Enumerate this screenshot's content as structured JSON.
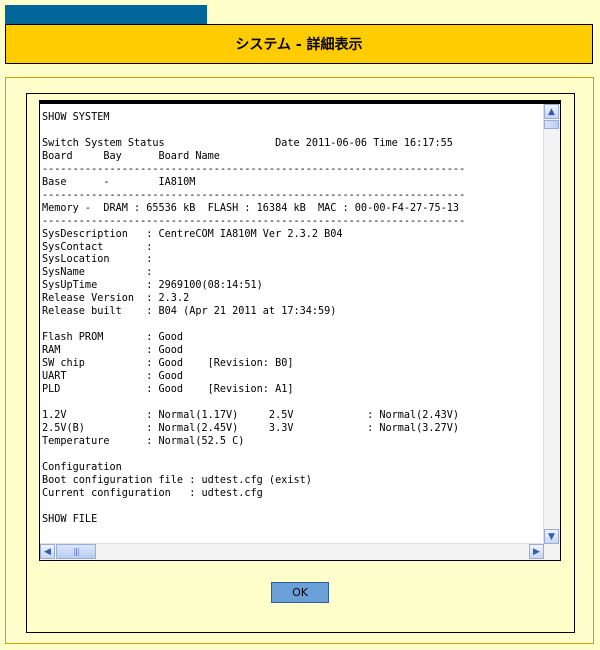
{
  "header": {
    "title": "システム - 詳細表示"
  },
  "output": {
    "text": "SHOW SYSTEM\n\nSwitch System Status                  Date 2011-06-06 Time 16:17:55\nBoard     Bay      Board Name\n---------------------------------------------------------------------\nBase      -        IA810M\n---------------------------------------------------------------------\nMemory -  DRAM : 65536 kB  FLASH : 16384 kB  MAC : 00-00-F4-27-75-13\n---------------------------------------------------------------------\nSysDescription   : CentreCOM IA810M Ver 2.3.2 B04\nSysContact       :\nSysLocation      :\nSysName          :\nSysUpTime        : 2969100(08:14:51)\nRelease Version  : 2.3.2\nRelease built    : B04 (Apr 21 2011 at 17:34:59)\n\nFlash PROM       : Good\nRAM              : Good\nSW chip          : Good    [Revision: B0]\nUART             : Good\nPLD              : Good    [Revision: A1]\n\n1.2V             : Normal(1.17V)     2.5V            : Normal(2.43V)\n2.5V(B)          : Normal(2.45V)     3.3V            : Normal(3.27V)\nTemperature      : Normal(52.5 C)\n\nConfiguration\nBoot configuration file : udtest.cfg (exist)\nCurrent configuration   : udtest.cfg\n\nSHOW FILE"
  },
  "buttons": {
    "ok_label": "OK"
  },
  "icons": {
    "scroll_up": "triangle-up",
    "scroll_down": "triangle-down",
    "scroll_left": "triangle-left",
    "scroll_right": "triangle-right"
  },
  "colors": {
    "background": "#ffffcc",
    "header_bar": "#ffcc00",
    "top_tab": "#006699",
    "ok_button": "#6a9fd8"
  }
}
